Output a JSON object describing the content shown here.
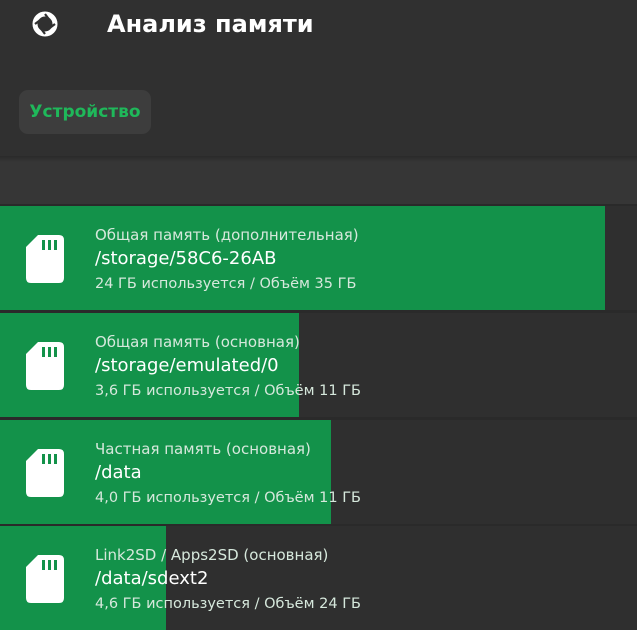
{
  "app_bar": {
    "icon": "aperture-icon",
    "title": "Анализ памяти"
  },
  "device_chip": {
    "label": "Устройство"
  },
  "colors": {
    "accent": "#1fb85a",
    "usage_fill": "#13924a",
    "background": "#2a2a2a"
  },
  "volumes": [
    {
      "type": "Общая память (дополнительная)",
      "path": "/storage/58C6-26AB",
      "usage": "24 ГБ используется / Объём 35 ГБ",
      "fill_percent": 95
    },
    {
      "type": "Общая память (основная)",
      "path": "/storage/emulated/0",
      "usage": "3,6 ГБ используется / Объём 11 ГБ",
      "fill_percent": 47
    },
    {
      "type": "Частная память (основная)",
      "path": "/data",
      "usage": "4,0 ГБ используется / Объём 11 ГБ",
      "fill_percent": 52
    },
    {
      "type": "Link2SD / Apps2SD (основная)",
      "path": "/data/sdext2",
      "usage": "4,6 ГБ используется / Объём 24 ГБ",
      "fill_percent": 26
    }
  ]
}
